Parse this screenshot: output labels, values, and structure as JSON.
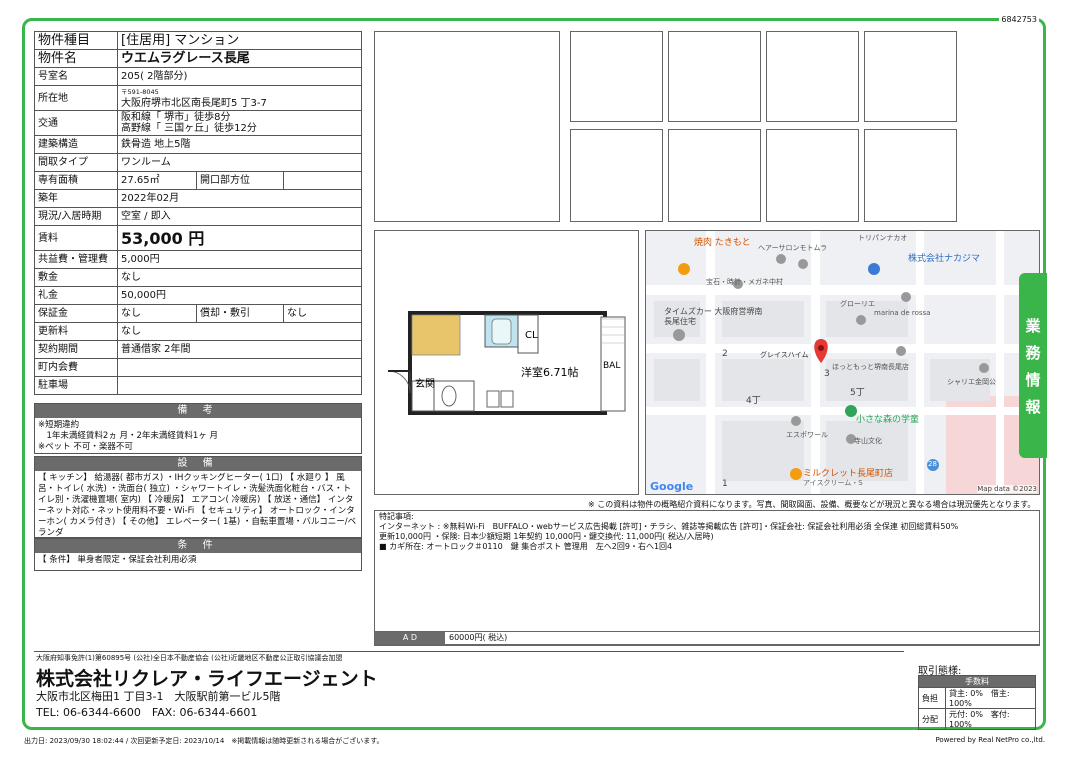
{
  "doc_id": "6842753",
  "info": {
    "type_label": "物件種目",
    "type_value": "[住居用] マンション",
    "name_label": "物件名",
    "name_value": "ウエムラグレース長尾",
    "room_label": "号室名",
    "room_value": "205( 2階部分)",
    "address_label": "所在地",
    "postal": "〒591-8045",
    "address_value": "大阪府堺市北区南長尾町5 丁3-7",
    "transport_label": "交通",
    "transport_1": "阪和線「 堺市」徒歩8分",
    "transport_2": "高野線「 三国ヶ丘」徒歩12分",
    "structure_label": "建築構造",
    "structure_value": "鉄骨造 地上5階",
    "layout_label": "間取タイプ",
    "layout_value": "ワンルーム",
    "area_label": "専有面積",
    "area_value": "27.65㎡",
    "direction_label": "開口部方位",
    "direction_value": "",
    "built_label": "築年",
    "built_value": "2022年02月",
    "status_label": "現況/入居時期",
    "status_value": "空室 / 即入",
    "rent_label": "賃料",
    "rent_value": "53,000 円",
    "mgmt_label": "共益費・管理費",
    "mgmt_value": "5,000円",
    "deposit_label": "敷金",
    "deposit_value": "なし",
    "keymoney_label": "礼金",
    "keymoney_value": "50,000円",
    "hoshokin_label": "保証金",
    "hoshokin_value": "なし",
    "shokyaku_label": "償却・敷引",
    "shokyaku_value": "なし",
    "renewal_label": "更新料",
    "renewal_value": "なし",
    "contract_label": "契約期間",
    "contract_value": "普通借家 2年間",
    "community_label": "町内会費",
    "community_value": "",
    "parking_label": "駐車場",
    "parking_value": ""
  },
  "remarks_section": {
    "title": "備 考",
    "lines": [
      "※短期違約",
      "　1年未満経賃料2ヵ 月・2年未満経賃料1ヶ 月",
      "※ペット 不可・楽器不可"
    ]
  },
  "facilities_section": {
    "title": "設 備",
    "text": "【 キッチン】 給湯器( 都市ガス) ・IHクッキングヒーター( 1口) 【 水廻り 】 風呂・トイレ( 水洗) ・洗面台( 独立) ・シャワートイレ・洗髪洗面化粧台・バス・トイレ別・洗濯機置場( 室内) 【 冷暖房】 エアコン( 冷暖房) 【 放送・通信】 インターネット対応・ネット使用料不要・Wi-Fi 【 セキュリティ】 オートロック・インターホン( カメラ付き) 【 その他】 エレベーター( 1基) ・自転車置場・バルコニー/ベランダ"
  },
  "conditions_section": {
    "title": "条 件",
    "text": "【 条件】 単身者限定・保証会社利用必須"
  },
  "floorplan": {
    "room": "洋室6.71帖",
    "balcony": "BAL",
    "closet": "CL",
    "entrance": "玄関"
  },
  "map": {
    "labels": [
      "焼肉 たきもと",
      "トリパンナカオ",
      "ヘアーサロンモトムラ",
      "株式会社ナカジマ",
      "宝石・時計・メガネ中村",
      "グローリエ",
      "タイムズカー 大阪府営堺南長尾住宅",
      "marina de rossa",
      "グレイスハイム",
      "ほっともっと堺南長尾店",
      "シャリエ金岡公",
      "小さな森の学童",
      "エスポワール",
      "寺山文化",
      "ミルクレット長尾町店",
      "アイスクリーム・S",
      "2",
      "3",
      "4丁",
      "5丁",
      "1",
      "28"
    ],
    "attribution": "Map data ©2023",
    "google": "Google"
  },
  "disclaimer": "※ この資料は物件の概略紹介資料になります。写真、間取図面、設備、概要などが現況と異なる場合は現況優先となります。",
  "special": {
    "title": "特記事項:",
    "line1": "インターネット : ※無料Wi-Fi　BUFFALO・webサービス広告掲載 [許可]・チラシ、雑誌等掲載広告 [許可]・保証会社: 保証会社利用必須 全保連 初回総賃料50%",
    "line2": "更新10,000円 ・保険: 日本少額短期 1年契約 10,000円・鍵交換代: 11,000円( 税込/入居時)",
    "line3": "■ カギ所在: オートロック＃0110　鍵 集合ポスト 管理用　左へ2回9・右へ1回4"
  },
  "ad": {
    "label": "A D",
    "value": "60000円( 税込)"
  },
  "side_tab": "業務情報",
  "company": {
    "license": "大阪府知事免許(1)第60895号 (公社)全日本不動産協会 (公社)近畿地区不動産公正取引協議会加盟",
    "name": "株式会社リクレア・ライフエージェント",
    "address": "大阪市北区梅田1 丁目3-1　大阪駅前第一ビル5階",
    "tel": "TEL: 06-6344-6600　FAX: 06-6344-6601"
  },
  "fees": {
    "title": "取引態様:",
    "header": "手数料",
    "row1_label": "負担",
    "row1_value": "貸主: 0%　借主: 100%",
    "row2_label": "分配",
    "row2_value": "元付: 0%　客付: 100%"
  },
  "footer": {
    "left": "出力日: 2023/09/30 18:02:44 / 次回更新予定日: 2023/10/14　※掲載情報は随時更新される場合がございます。",
    "right": "Powered by Real NetPro co.,ltd."
  },
  "colors": {
    "accent": "#39b54a",
    "header_bg": "#6b6b6b",
    "map_bg": "#eef0f3"
  }
}
